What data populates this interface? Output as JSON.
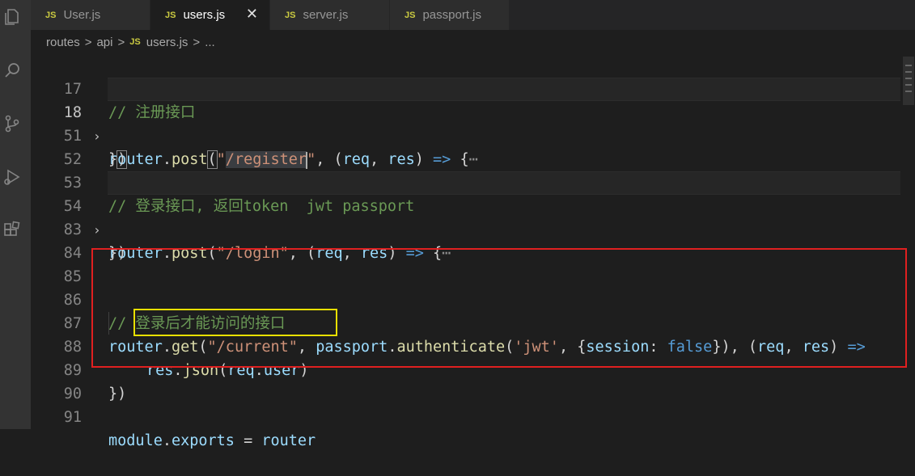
{
  "tabs": [
    {
      "icon": "JS",
      "label": "User.js",
      "active": false
    },
    {
      "icon": "JS",
      "label": "users.js",
      "active": true,
      "close": "✕"
    },
    {
      "icon": "JS",
      "label": "server.js",
      "active": false
    },
    {
      "icon": "JS",
      "label": "passport.js",
      "active": false
    }
  ],
  "breadcrumb": {
    "parts": [
      "routes",
      "api",
      "users.js",
      "..."
    ],
    "separator": ">",
    "file_icon": "JS"
  },
  "activity_bar": {
    "icons": [
      "files-icon",
      "search-icon",
      "source-control-icon",
      "run-debug-icon",
      "extensions-icon"
    ]
  },
  "editor": {
    "current_line": "18",
    "lines": [
      {
        "no": "17",
        "comment": "// 注册接口"
      },
      {
        "no": "18",
        "folded": true,
        "t1": "router",
        "t2": ".",
        "t3": "post",
        "t4": "(",
        "t5": "\"",
        "t6": "/register",
        "t7": "\"",
        "t8": ", (",
        "t9": "req",
        "t10": ", ",
        "t11": "res",
        "t12": ") ",
        "t13": "=>",
        "t14": " {",
        "t15": "⋯"
      },
      {
        "no": "51",
        "t1": "}",
        "t2": ")"
      },
      {
        "no": "52"
      },
      {
        "no": "53",
        "comment": "// 登录接口, 返回token  jwt passport"
      },
      {
        "no": "54",
        "folded": true,
        "t1": "router",
        "t2": ".",
        "t3": "post",
        "t4": "(",
        "t5": "\"/login\"",
        "t6": ", (",
        "t7": "req",
        "t8": ", ",
        "t9": "res",
        "t10": ") ",
        "t11": "=>",
        "t12": " {",
        "t13": "⋯"
      },
      {
        "no": "83",
        "t1": "})"
      },
      {
        "no": "84"
      },
      {
        "no": "85"
      },
      {
        "no": "86",
        "comment": "// 登录后才能访问的接口"
      },
      {
        "no": "87",
        "t1": "router",
        "t2": ".",
        "t3": "get",
        "t4": "(",
        "t5": "\"/current\"",
        "t6": ", ",
        "t7": "passport",
        "t8": ".",
        "t9": "authenticate",
        "t10": "(",
        "t11": "'jwt'",
        "t12": ", {",
        "t13": "session",
        "t14": ": ",
        "t15": "false",
        "t16": "}), (",
        "t17": "req",
        "t18": ", ",
        "t19": "res",
        "t20": ") ",
        "t21": "=>"
      },
      {
        "no": "88",
        "t1": "res",
        "t2": ".",
        "t3": "json",
        "t4": "(",
        "t5": "req",
        "t6": ".",
        "t7": "user",
        "t8": ")"
      },
      {
        "no": "89",
        "t1": "})"
      },
      {
        "no": "90"
      },
      {
        "no": "91",
        "t1": "module",
        "t2": ".",
        "t3": "exports",
        "t4": " = ",
        "t5": "router"
      }
    ]
  },
  "annotations": {
    "red_box_color": "#e02020",
    "yellow_box_color": "#e8e000"
  },
  "colors": {
    "background": "#1e1e1e",
    "comment": "#6a9955",
    "variable": "#9cdcfe",
    "function": "#dcdcaa",
    "string": "#ce9178",
    "keyword": "#569cd6"
  }
}
